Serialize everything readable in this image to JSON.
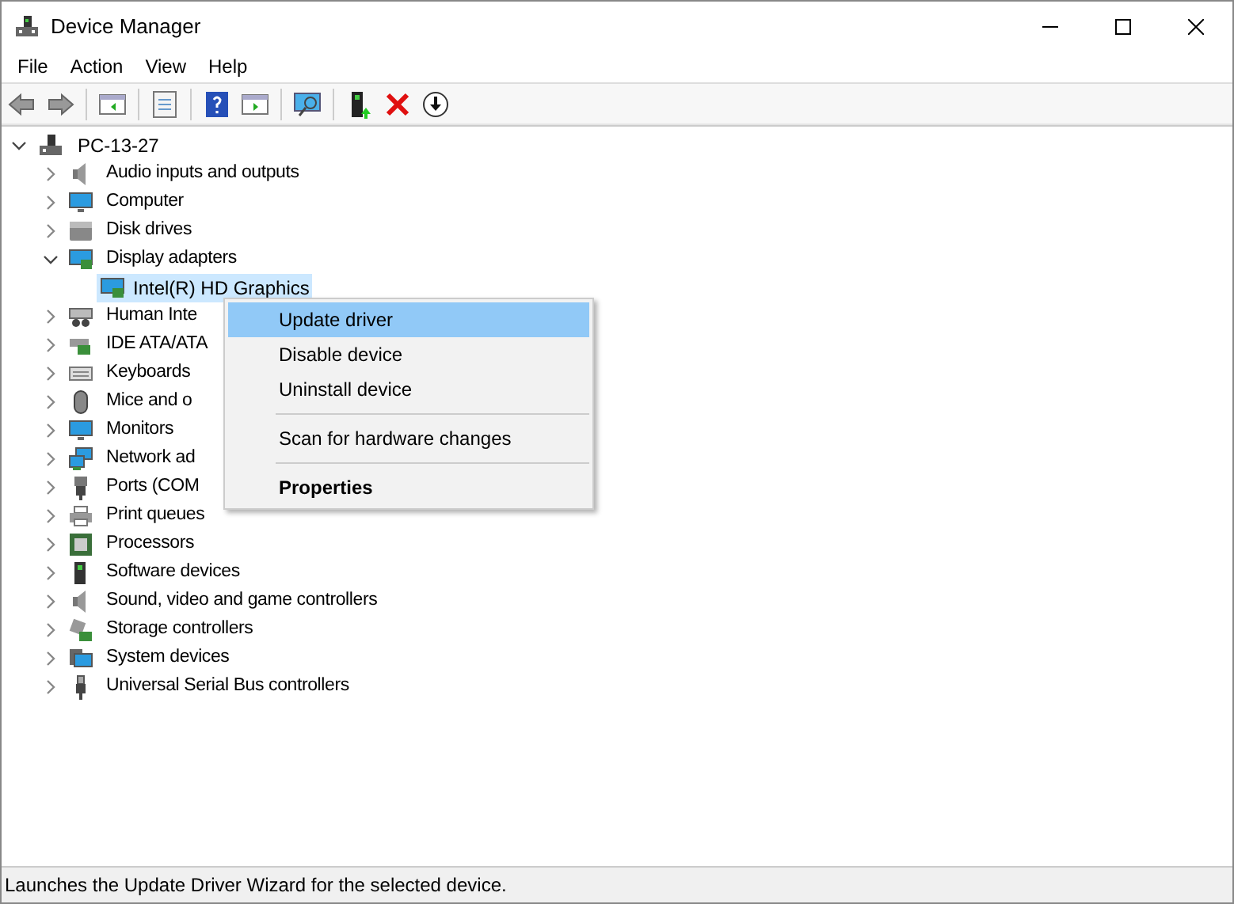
{
  "window": {
    "title": "Device Manager"
  },
  "menu_bar": [
    "File",
    "Action",
    "View",
    "Help"
  ],
  "tree": {
    "label": "PC-13-27",
    "expanded": true,
    "selected": false,
    "children": [
      {
        "label": "Audio inputs and outputs",
        "expanded": false,
        "selected": false
      },
      {
        "label": "Computer",
        "expanded": false,
        "selected": false
      },
      {
        "label": "Disk drives",
        "expanded": false,
        "selected": false
      },
      {
        "label": "Display adapters",
        "expanded": true,
        "selected": false,
        "children": [
          {
            "label": "Intel(R) HD Graphics",
            "selected": true
          }
        ]
      },
      {
        "label": "Human Inte",
        "expanded": false,
        "selected": false
      },
      {
        "label": "IDE ATA/ATA",
        "expanded": false,
        "selected": false
      },
      {
        "label": "Keyboards",
        "expanded": false,
        "selected": false
      },
      {
        "label": "Mice and o",
        "expanded": false,
        "selected": false
      },
      {
        "label": "Monitors",
        "expanded": false,
        "selected": false
      },
      {
        "label": "Network ad",
        "expanded": false,
        "selected": false
      },
      {
        "label": "Ports (COM",
        "expanded": false,
        "selected": false
      },
      {
        "label": "Print queues",
        "expanded": false,
        "selected": false
      },
      {
        "label": "Processors",
        "expanded": false,
        "selected": false
      },
      {
        "label": "Software devices",
        "expanded": false,
        "selected": false
      },
      {
        "label": "Sound, video and game controllers",
        "expanded": false,
        "selected": false
      },
      {
        "label": "Storage controllers",
        "expanded": false,
        "selected": false
      },
      {
        "label": "System devices",
        "expanded": false,
        "selected": false
      },
      {
        "label": "Universal Serial Bus controllers",
        "expanded": false,
        "selected": false
      }
    ]
  },
  "context_menu": [
    {
      "kind": "item",
      "label": "Update driver",
      "selected": true,
      "default": false
    },
    {
      "kind": "item",
      "label": "Disable device",
      "selected": false,
      "default": false
    },
    {
      "kind": "item",
      "label": "Uninstall device",
      "selected": false,
      "default": false
    },
    {
      "kind": "separator"
    },
    {
      "kind": "item",
      "label": "Scan for hardware changes",
      "selected": false,
      "default": false
    },
    {
      "kind": "separator"
    },
    {
      "kind": "item",
      "label": "Properties",
      "selected": false,
      "default": true
    }
  ],
  "status_bar": "Launches the Update Driver Wizard for the selected device."
}
